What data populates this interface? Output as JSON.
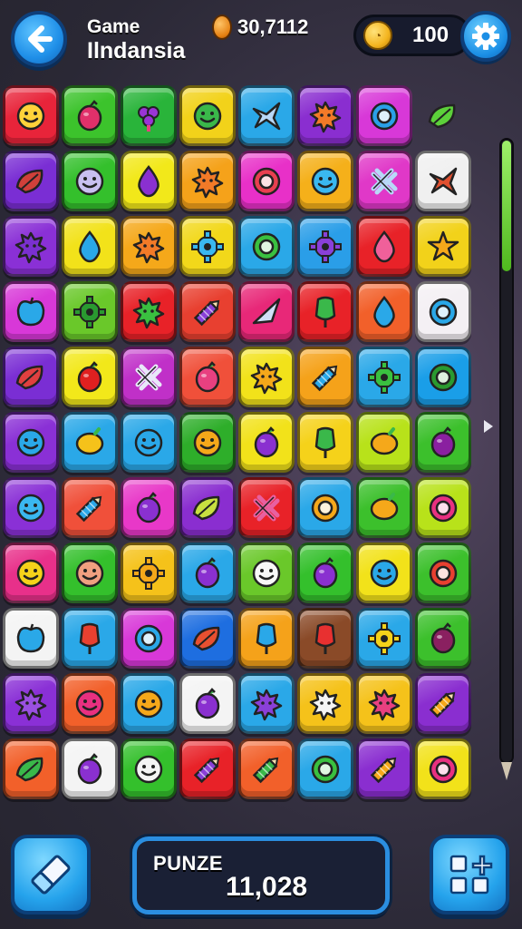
{
  "header": {
    "title_line1": "Game",
    "title_line2": "Ilndansia",
    "coin_score": "30,7112",
    "coin_balance": "100"
  },
  "icons": {
    "back": "arrow-left-icon",
    "settings": "gear-icon",
    "eraser": "eraser-icon",
    "shuffle": "shuffle-grid-icon",
    "coin": "coin-icon"
  },
  "board": {
    "rows": [
      [
        [
          "#e8243a",
          "smiley",
          "#ffd23a"
        ],
        [
          "#3cc32c",
          "berry",
          "#e0306a"
        ],
        [
          "#29b43a",
          "grapes",
          "#9a34d6"
        ],
        [
          "#f2d21a",
          "smiley",
          "#3ab84a"
        ],
        [
          "#2aa8e8",
          "ribbon",
          "#b8d8f8"
        ],
        [
          "#8a2ed0",
          "splat",
          "#f27a28"
        ],
        [
          "#d838d8",
          "ring",
          "#2aa0e8"
        ],
        [
          "none",
          "leaf",
          "#5cd03a"
        ]
      ],
      [
        [
          "#7a2ed4",
          "leaf",
          "#d0403a"
        ],
        [
          "#34c02c",
          "smiley",
          "#c8c0f0"
        ],
        [
          "#f2e81a",
          "drop",
          "#8a30d0"
        ],
        [
          "#f5a21a",
          "splat",
          "#f27a28"
        ],
        [
          "#e830c8",
          "ring",
          "#e84050"
        ],
        [
          "#f5b01a",
          "smiley",
          "#3ab8f0"
        ],
        [
          "#e038c8",
          "cross",
          "#b8d8f8"
        ],
        [
          "#f0f0f0",
          "ribbon",
          "#e05030"
        ]
      ],
      [
        [
          "#8a30d6",
          "splat",
          "#7a30d0"
        ],
        [
          "#f2e21a",
          "drop",
          "#2aa8e8"
        ],
        [
          "#f5a81a",
          "splat",
          "#f27a28"
        ],
        [
          "#f2d81a",
          "gear",
          "#3ab8f0"
        ],
        [
          "#2aa8e8",
          "ring",
          "#3ac040"
        ],
        [
          "#2a9ee8",
          "gear",
          "#8a40d8"
        ],
        [
          "#e82228",
          "drop",
          "#f0609a"
        ],
        [
          "#f2d21a",
          "star",
          "#f5a81a"
        ]
      ],
      [
        [
          "#d838d8",
          "apple",
          "#2aa8e8"
        ],
        [
          "#6ac82a",
          "gear",
          "#2a9a30"
        ],
        [
          "#e82228",
          "splat",
          "#3ac040"
        ],
        [
          "#e84030",
          "crayon",
          "#8a40d8"
        ],
        [
          "#e82878",
          "arrow",
          "#d0e0f8"
        ],
        [
          "#e82228",
          "lantern",
          "#3ab84a"
        ],
        [
          "#f2602a",
          "drop",
          "#2aa8e8"
        ],
        [
          "#f4f0f4",
          "ring",
          "#2aa8e8"
        ]
      ],
      [
        [
          "#7a2ed4",
          "leaf",
          "#e04040"
        ],
        [
          "#f2e81a",
          "berry",
          "#e02020"
        ],
        [
          "#c030c8",
          "cross",
          "#e8e8f8"
        ],
        [
          "#f0503a",
          "berry",
          "#e84080"
        ],
        [
          "#f2e21a",
          "splat",
          "#f5a81a"
        ],
        [
          "#f5a21a",
          "crayon",
          "#2aa8e8"
        ],
        [
          "#2aa8e8",
          "gear",
          "#3ac040"
        ],
        [
          "#1a9ee8",
          "ring",
          "#2a9a30"
        ]
      ],
      [
        [
          "#8a30d6",
          "smiley",
          "#2aa8e8"
        ],
        [
          "#2aa8e8",
          "lemon",
          "#f5c21a"
        ],
        [
          "#2aa8e8",
          "smiley",
          "#2aa8e8"
        ],
        [
          "#2eae2a",
          "smiley",
          "#f5a81a"
        ],
        [
          "#f2e21a",
          "berry",
          "#8a30d0"
        ],
        [
          "#f5d21a",
          "lantern",
          "#3ab84a"
        ],
        [
          "#b8e21a",
          "lemon",
          "#f5a81a"
        ],
        [
          "#3cc02c",
          "berry",
          "#8a20a0"
        ]
      ],
      [
        [
          "#8a30d6",
          "smiley",
          "#3ab8f0"
        ],
        [
          "#f0503a",
          "crayon",
          "#2aa8e8"
        ],
        [
          "#e838c8",
          "berry",
          "#8a30d0"
        ],
        [
          "#8a2ed0",
          "leaf",
          "#c8e040"
        ],
        [
          "#e82228",
          "cross",
          "#e860a0"
        ],
        [
          "#2aa8e8",
          "ring",
          "#f5a81a"
        ],
        [
          "#3cc02c",
          "lemon",
          "#f5a81a"
        ],
        [
          "#b8e21a",
          "ring",
          "#e83080"
        ]
      ],
      [
        [
          "#e8308a",
          "smiley",
          "#f5d21a"
        ],
        [
          "#34c02c",
          "smiley",
          "#f0a080"
        ],
        [
          "#f5c21a",
          "gear",
          "#f5a81a"
        ],
        [
          "#2aa8e8",
          "berry",
          "#8a30d0"
        ],
        [
          "#6ac82a",
          "smiley",
          "#f8f8f8"
        ],
        [
          "#34c02c",
          "berry",
          "#8a30d0"
        ],
        [
          "#f2e21a",
          "smiley",
          "#2aa8e8"
        ],
        [
          "#3cc02c",
          "ring",
          "#e84030"
        ]
      ],
      [
        [
          "#f4f4f4",
          "apple",
          "#2aa8e8"
        ],
        [
          "#2aa8e8",
          "lantern",
          "#e84030"
        ],
        [
          "#d838d8",
          "ring",
          "#2aa8e8"
        ],
        [
          "#1e6ee0",
          "leaf",
          "#e85030"
        ],
        [
          "#f5a21a",
          "lantern",
          "#2aa8e8"
        ],
        [
          "#8a4a28",
          "lantern",
          "#e83030"
        ],
        [
          "#2aa8e8",
          "gear",
          "#f5d21a"
        ],
        [
          "#3cc02c",
          "berry",
          "#8a2060"
        ]
      ],
      [
        [
          "#8a30d6",
          "splat",
          "#9a50e0"
        ],
        [
          "#f2602a",
          "smiley",
          "#e83080"
        ],
        [
          "#2aa8e8",
          "smiley",
          "#f5a81a"
        ],
        [
          "#f4f4f4",
          "berry",
          "#8a30d0"
        ],
        [
          "#2aa8e8",
          "splat",
          "#8a40d8"
        ],
        [
          "#f5c21a",
          "splat",
          "#f4f4f4"
        ],
        [
          "#f5c21a",
          "splat",
          "#e84080"
        ],
        [
          "#8a2ed0",
          "crayon",
          "#f5a81a"
        ]
      ],
      [
        [
          "#f2602a",
          "leaf",
          "#3ab84a"
        ],
        [
          "#f4f4f4",
          "berry",
          "#8a30d0"
        ],
        [
          "#34c02c",
          "smiley",
          "#f4f4f4"
        ],
        [
          "#e82228",
          "crayon",
          "#8a40d8"
        ],
        [
          "#f2602a",
          "crayon",
          "#3ab84a"
        ],
        [
          "#2aa8e8",
          "ring",
          "#3ac040"
        ],
        [
          "#8a2ed0",
          "crayon",
          "#f5a81a"
        ],
        [
          "#f2e21a",
          "ring",
          "#e83080"
        ]
      ]
    ]
  },
  "level_progress": 0.21,
  "footer": {
    "score_label": "PUNZE",
    "score_value": "11,028"
  }
}
